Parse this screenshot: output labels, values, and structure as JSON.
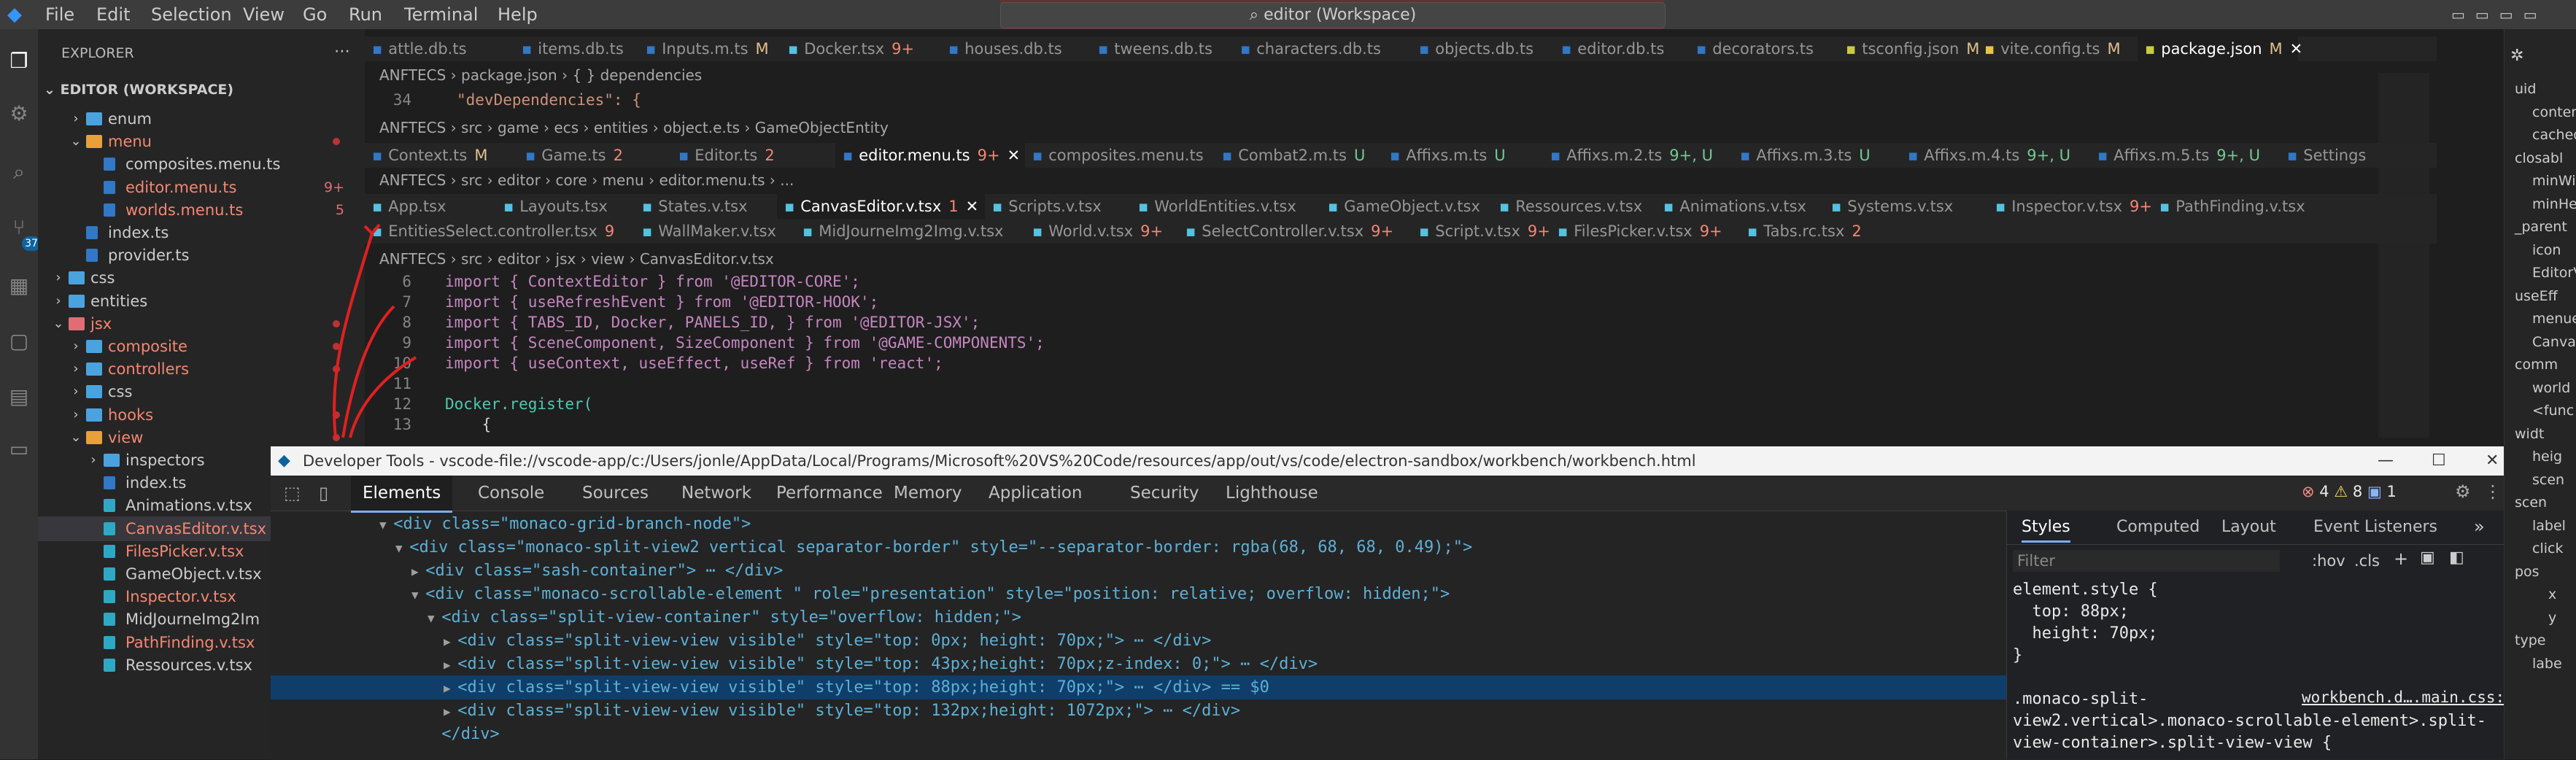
{
  "titlebar": {
    "menus": [
      "File",
      "Edit",
      "Selection",
      "View",
      "Go",
      "Run",
      "Terminal",
      "Help"
    ],
    "search_text": "editor (Workspace)"
  },
  "sidebar": {
    "explorer_title": "EXPLORER",
    "workspace_title": "EDITOR (WORKSPACE)",
    "rows": [
      {
        "label": "enum",
        "indent": 1,
        "kind": "folder",
        "open": false
      },
      {
        "label": "menu",
        "indent": 1,
        "kind": "folder",
        "open": true,
        "red": true
      },
      {
        "label": "composites.menu.ts",
        "indent": 2,
        "kind": "ts"
      },
      {
        "label": "editor.menu.ts",
        "indent": 2,
        "kind": "ts",
        "red": true,
        "badge": "9+"
      },
      {
        "label": "worlds.menu.ts",
        "indent": 2,
        "kind": "ts",
        "red": true,
        "badge": "5"
      },
      {
        "label": "index.ts",
        "indent": 1,
        "kind": "ts"
      },
      {
        "label": "provider.ts",
        "indent": 1,
        "kind": "ts"
      },
      {
        "label": "css",
        "indent": 0,
        "kind": "folder",
        "open": false
      },
      {
        "label": "entities",
        "indent": 0,
        "kind": "folder",
        "open": false
      },
      {
        "label": "jsx",
        "indent": 0,
        "kind": "folder",
        "open": true,
        "red": true
      },
      {
        "label": "composite",
        "indent": 1,
        "kind": "folder",
        "open": false,
        "red": true
      },
      {
        "label": "controllers",
        "indent": 1,
        "kind": "folder",
        "open": false,
        "red": true
      },
      {
        "label": "css",
        "indent": 1,
        "kind": "folder",
        "open": false
      },
      {
        "label": "hooks",
        "indent": 1,
        "kind": "folder",
        "open": false,
        "red": true
      },
      {
        "label": "view",
        "indent": 1,
        "kind": "folder",
        "open": true,
        "red": true
      },
      {
        "label": "inspectors",
        "indent": 2,
        "kind": "folder",
        "open": false
      },
      {
        "label": "index.ts",
        "indent": 2,
        "kind": "ts"
      },
      {
        "label": "Animations.v.tsx",
        "indent": 2,
        "kind": "tsx"
      },
      {
        "label": "CanvasEditor.v.tsx",
        "indent": 2,
        "kind": "tsx",
        "red": true,
        "selected": true
      },
      {
        "label": "FilesPicker.v.tsx",
        "indent": 2,
        "kind": "tsx",
        "red": true
      },
      {
        "label": "GameObject.v.tsx",
        "indent": 2,
        "kind": "tsx"
      },
      {
        "label": "Inspector.v.tsx",
        "indent": 2,
        "kind": "tsx",
        "red": true
      },
      {
        "label": "MidJourneImg2Im",
        "indent": 2,
        "kind": "tsx"
      },
      {
        "label": "PathFinding.v.tsx",
        "indent": 2,
        "kind": "tsx",
        "red": true
      },
      {
        "label": "Ressources.v.tsx",
        "indent": 2,
        "kind": "tsx"
      }
    ]
  },
  "group1": {
    "tabs": [
      {
        "label": "attle.db.ts",
        "mark": ""
      },
      {
        "label": "items.db.ts",
        "mark": ""
      },
      {
        "label": "Inputs.m.ts",
        "mark": "M"
      },
      {
        "label": "Docker.tsx",
        "mark": "9+"
      },
      {
        "label": "houses.db.ts",
        "mark": ""
      },
      {
        "label": "tweens.db.ts",
        "mark": ""
      },
      {
        "label": "characters.db.ts",
        "mark": ""
      },
      {
        "label": "objects.db.ts",
        "mark": ""
      },
      {
        "label": "editor.db.ts",
        "mark": ""
      },
      {
        "label": "decorators.ts",
        "mark": ""
      },
      {
        "label": "tsconfig.json",
        "mark": "M"
      },
      {
        "label": "vite.config.ts",
        "mark": "M"
      },
      {
        "label": "package.json",
        "mark": "M",
        "active": true
      }
    ],
    "breadcrumb": [
      "ANFTECS",
      "package.json",
      "{ } dependencies"
    ],
    "line_no": "34",
    "code": "\"devDependencies\": {"
  },
  "group2": {
    "breadcrumb": [
      "ANFTECS",
      "src",
      "game",
      "ecs",
      "entities",
      "object.e.ts",
      "GameObjectEntity"
    ],
    "tabs": [
      {
        "label": "Context.ts",
        "mark": "M"
      },
      {
        "label": "Game.ts",
        "mark": "2"
      },
      {
        "label": "Editor.ts",
        "mark": "2"
      },
      {
        "label": "editor.menu.ts",
        "mark": "9+",
        "active": true
      },
      {
        "label": "composites.menu.ts",
        "mark": ""
      },
      {
        "label": "Combat2.m.ts",
        "mark": "U"
      },
      {
        "label": "Affixs.m.ts",
        "mark": "U"
      },
      {
        "label": "Affixs.m.2.ts",
        "mark": "9+, U"
      },
      {
        "label": "Affixs.m.3.ts",
        "mark": "U"
      },
      {
        "label": "Affixs.m.4.ts",
        "mark": "9+, U"
      },
      {
        "label": "Affixs.m.5.ts",
        "mark": "9+, U"
      },
      {
        "label": "Settings",
        "mark": ""
      }
    ],
    "breadcrumb2": [
      "ANFTECS",
      "src",
      "editor",
      "core",
      "menu",
      "editor.menu.ts",
      "..."
    ]
  },
  "group3": {
    "tabs_row1": [
      {
        "label": "App.tsx",
        "mark": ""
      },
      {
        "label": "Layouts.tsx",
        "mark": ""
      },
      {
        "label": "States.v.tsx",
        "mark": ""
      },
      {
        "label": "CanvasEditor.v.tsx",
        "mark": "1",
        "active": true
      },
      {
        "label": "Scripts.v.tsx",
        "mark": ""
      },
      {
        "label": "WorldEntities.v.tsx",
        "mark": ""
      },
      {
        "label": "GameObject.v.tsx",
        "mark": ""
      },
      {
        "label": "Ressources.v.tsx",
        "mark": ""
      },
      {
        "label": "Animations.v.tsx",
        "mark": ""
      },
      {
        "label": "Systems.v.tsx",
        "mark": ""
      },
      {
        "label": "Inspector.v.tsx",
        "mark": "9+"
      },
      {
        "label": "PathFinding.v.tsx",
        "mark": ""
      }
    ],
    "tabs_row2": [
      {
        "label": "EntitiesSelect.controller.tsx",
        "mark": "9"
      },
      {
        "label": "WallMaker.v.tsx",
        "mark": ""
      },
      {
        "label": "MidJourneImg2Img.v.tsx",
        "mark": ""
      },
      {
        "label": "World.v.tsx",
        "mark": "9+"
      },
      {
        "label": "SelectController.v.tsx",
        "mark": "9+"
      },
      {
        "label": "Script.v.tsx",
        "mark": "9+"
      },
      {
        "label": "FilesPicker.v.tsx",
        "mark": "9+"
      },
      {
        "label": "Tabs.rc.tsx",
        "mark": "2"
      }
    ],
    "breadcrumb": [
      "ANFTECS",
      "src",
      "editor",
      "jsx",
      "view",
      "CanvasEditor.v.tsx"
    ],
    "lines": [
      {
        "n": "6",
        "t": "import { ContextEditor } from '@EDITOR-CORE';"
      },
      {
        "n": "7",
        "t": "import { useRefreshEvent } from '@EDITOR-HOOK';"
      },
      {
        "n": "8",
        "t": "import { TABS_ID, Docker, PANELS_ID, } from '@EDITOR-JSX';"
      },
      {
        "n": "9",
        "t": "import { SceneComponent, SizeComponent } from '@GAME-COMPONENTS';"
      },
      {
        "n": "10",
        "t": "import { useContext, useEffect, useRef } from 'react';"
      },
      {
        "n": "11",
        "t": ""
      },
      {
        "n": "12",
        "t": "Docker.register("
      },
      {
        "n": "13",
        "t": "    {"
      }
    ]
  },
  "devtools": {
    "title": "Developer Tools - vscode-file://vscode-app/c:/Users/jonle/AppData/Local/Programs/Microsoft%20VS%20Code/resources/app/out/vs/code/electron-sandbox/workbench/workbench.html",
    "tabs": [
      "Elements",
      "Console",
      "Sources",
      "Network",
      "Performance",
      "Memory",
      "Application",
      "Security",
      "Lighthouse"
    ],
    "errors": "4",
    "warnings": "8",
    "messages": "1",
    "dom_lines": [
      {
        "indent": 0,
        "arrow": "▼",
        "html": "<div class=\"monaco-grid-branch-node\">"
      },
      {
        "indent": 1,
        "arrow": "▼",
        "html": "<div class=\"monaco-split-view2 vertical separator-border\" style=\"--separator-border: rgba(68, 68, 68, 0.49);\">"
      },
      {
        "indent": 2,
        "arrow": "▶",
        "html": "<div class=\"sash-container\"> ⋯ </div>"
      },
      {
        "indent": 2,
        "arrow": "▼",
        "html": "<div class=\"monaco-scrollable-element \" role=\"presentation\" style=\"position: relative; overflow: hidden;\">"
      },
      {
        "indent": 3,
        "arrow": "▼",
        "html": "<div class=\"split-view-container\" style=\"overflow: hidden;\">"
      },
      {
        "indent": 4,
        "arrow": "▶",
        "html": "<div class=\"split-view-view visible\" style=\"top: 0px; height: 70px;\"> ⋯ </div>"
      },
      {
        "indent": 4,
        "arrow": "▶",
        "html": "<div class=\"split-view-view visible\" style=\"top: 43px;height: 70px;z-index: 0;\"> ⋯ </div>"
      },
      {
        "indent": 4,
        "arrow": "▶",
        "html": "<div class=\"split-view-view visible\" style=\"top: 88px;height: 70px;\"> ⋯ </div> == $0",
        "selected": true
      },
      {
        "indent": 4,
        "arrow": "▶",
        "html": "<div class=\"split-view-view visible\" style=\"top: 132px;height: 1072px;\"> ⋯ </div>"
      },
      {
        "indent": 3,
        "arrow": "",
        "html": "</div>"
      }
    ],
    "styles_tabs": [
      "Styles",
      "Computed",
      "Layout",
      "Event Listeners"
    ],
    "filter_placeholder": "Filter",
    "hov": ":hov",
    "cls": ".cls",
    "style_rules": [
      "element.style {",
      "  top: 88px;",
      "  height: 70px;",
      "}",
      ".monaco-split-",
      "view2.vertical>.monaco-scrollable-element>.split-",
      "view-container>.split-view-view {"
    ],
    "source_link": "workbench.d….main.css:3"
  },
  "outline": {
    "items": [
      "uid",
      "conter",
      "cached",
      "closabl",
      "minWi",
      "minHei",
      "_parent",
      "icon",
      "EditorV",
      "useEff",
      "menue",
      "Canvas",
      "comm",
      "world",
      "<func",
      "widt",
      "heig",
      "scen",
      "scen",
      "label",
      "click",
      "pos",
      "x",
      "y",
      "type",
      "labe"
    ]
  },
  "activity_badge": "37"
}
